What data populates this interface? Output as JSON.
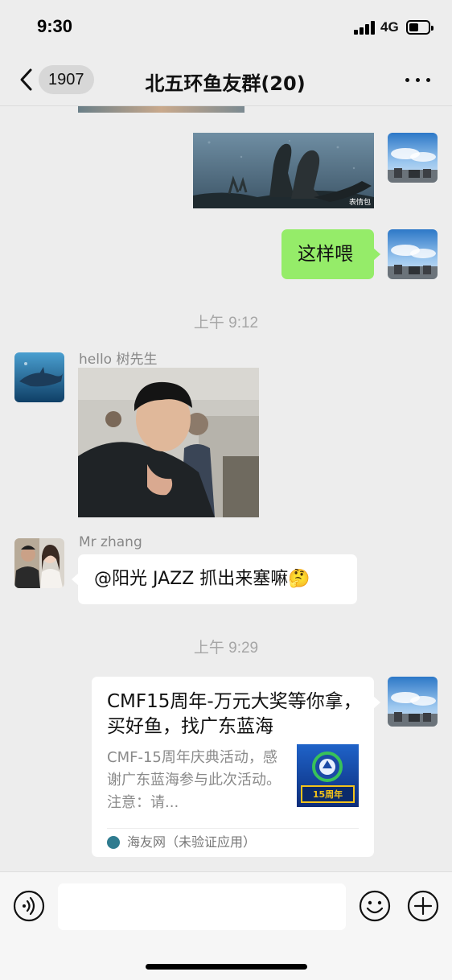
{
  "status_bar": {
    "time": "9:30",
    "network": "4G"
  },
  "nav": {
    "unread_count": "1907",
    "title": "北五环鱼友群(20)"
  },
  "messages": {
    "mine_text": "这样喂",
    "time_1": "上午 9:12",
    "sender_1": "hello 树先生",
    "sender_2": "Mr zhang",
    "text_2": "@阳光 JAZZ 抓出来塞嘛🤔",
    "time_2": "上午 9:29"
  },
  "link_card": {
    "title": "CMF15周年-万元大奖等你拿，买好鱼，找广东蓝海",
    "description": "CMF-15周年庆典活动，感谢广东蓝海参与此次活动。注意：请...",
    "source": "海友网（未验证应用）"
  },
  "images": {
    "meme_1_watermark": "表情包",
    "card_thumb_text": "15周年"
  },
  "icons": {
    "back": "chevron-left-icon",
    "more": "more-dots-icon",
    "voice": "voice-icon",
    "emoji": "emoji-icon",
    "add": "plus-icon"
  },
  "colors": {
    "background": "#ededed",
    "bubble_mine": "#95ec69",
    "bubble_other": "#ffffff",
    "time_text": "#a6a6a6"
  }
}
